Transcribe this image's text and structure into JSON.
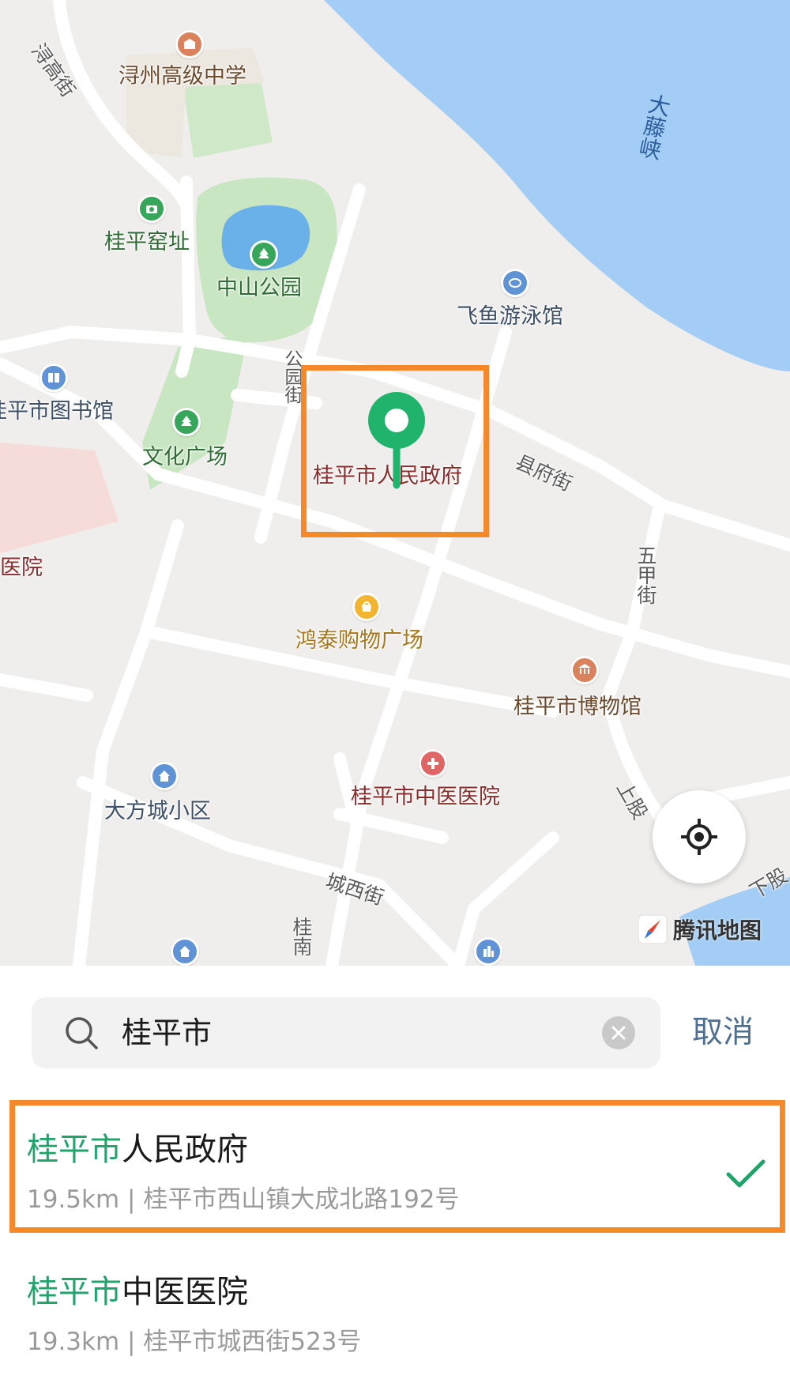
{
  "map": {
    "labels": {
      "school": "浔州高级中学",
      "street_xungao": "浔高街",
      "kiln_site": "桂平窑址",
      "zhongshan_park": "中山公园",
      "pool": "飞鱼游泳馆",
      "river": "大藤峡",
      "library": "桂平市图书馆",
      "street_gongyuan": "公园街",
      "culture_square": "文化广场",
      "government": "桂平市人民政府",
      "street_xianfu": "县府街",
      "hospital_left": "医院",
      "street_wujia": "五甲街",
      "mall": "鸿泰购物广场",
      "museum": "桂平市博物馆",
      "tcm_hospital": "桂平市中医医院",
      "community": "大方城小区",
      "street_shanggu": "上股",
      "street_chengxi": "城西街",
      "street_xiagu": "下股",
      "street_guinan": "桂南"
    },
    "brand": "腾讯地图",
    "colors": {
      "background": "#efeeec",
      "water": "#a3cdf4",
      "park": "#c8e6c2",
      "road": "#ffffff",
      "pin": "#1fb36b",
      "highlight": "#f5892a"
    }
  },
  "search": {
    "query": "桂平市",
    "cancel_label": "取消"
  },
  "results": [
    {
      "title_highlight": "桂平市",
      "title_rest": "人民政府",
      "distance": "19.5km",
      "separator": "|",
      "address": "桂平市西山镇大成北路192号",
      "selected": true
    },
    {
      "title_highlight": "桂平市",
      "title_rest": "中医医院",
      "distance": "19.3km",
      "separator": "|",
      "address": "桂平市城西街523号",
      "selected": false
    }
  ],
  "icons": {
    "search": "search-icon",
    "clear": "clear-icon",
    "check": "check-icon",
    "locate": "locate-icon",
    "pin": "location-pin-icon"
  }
}
